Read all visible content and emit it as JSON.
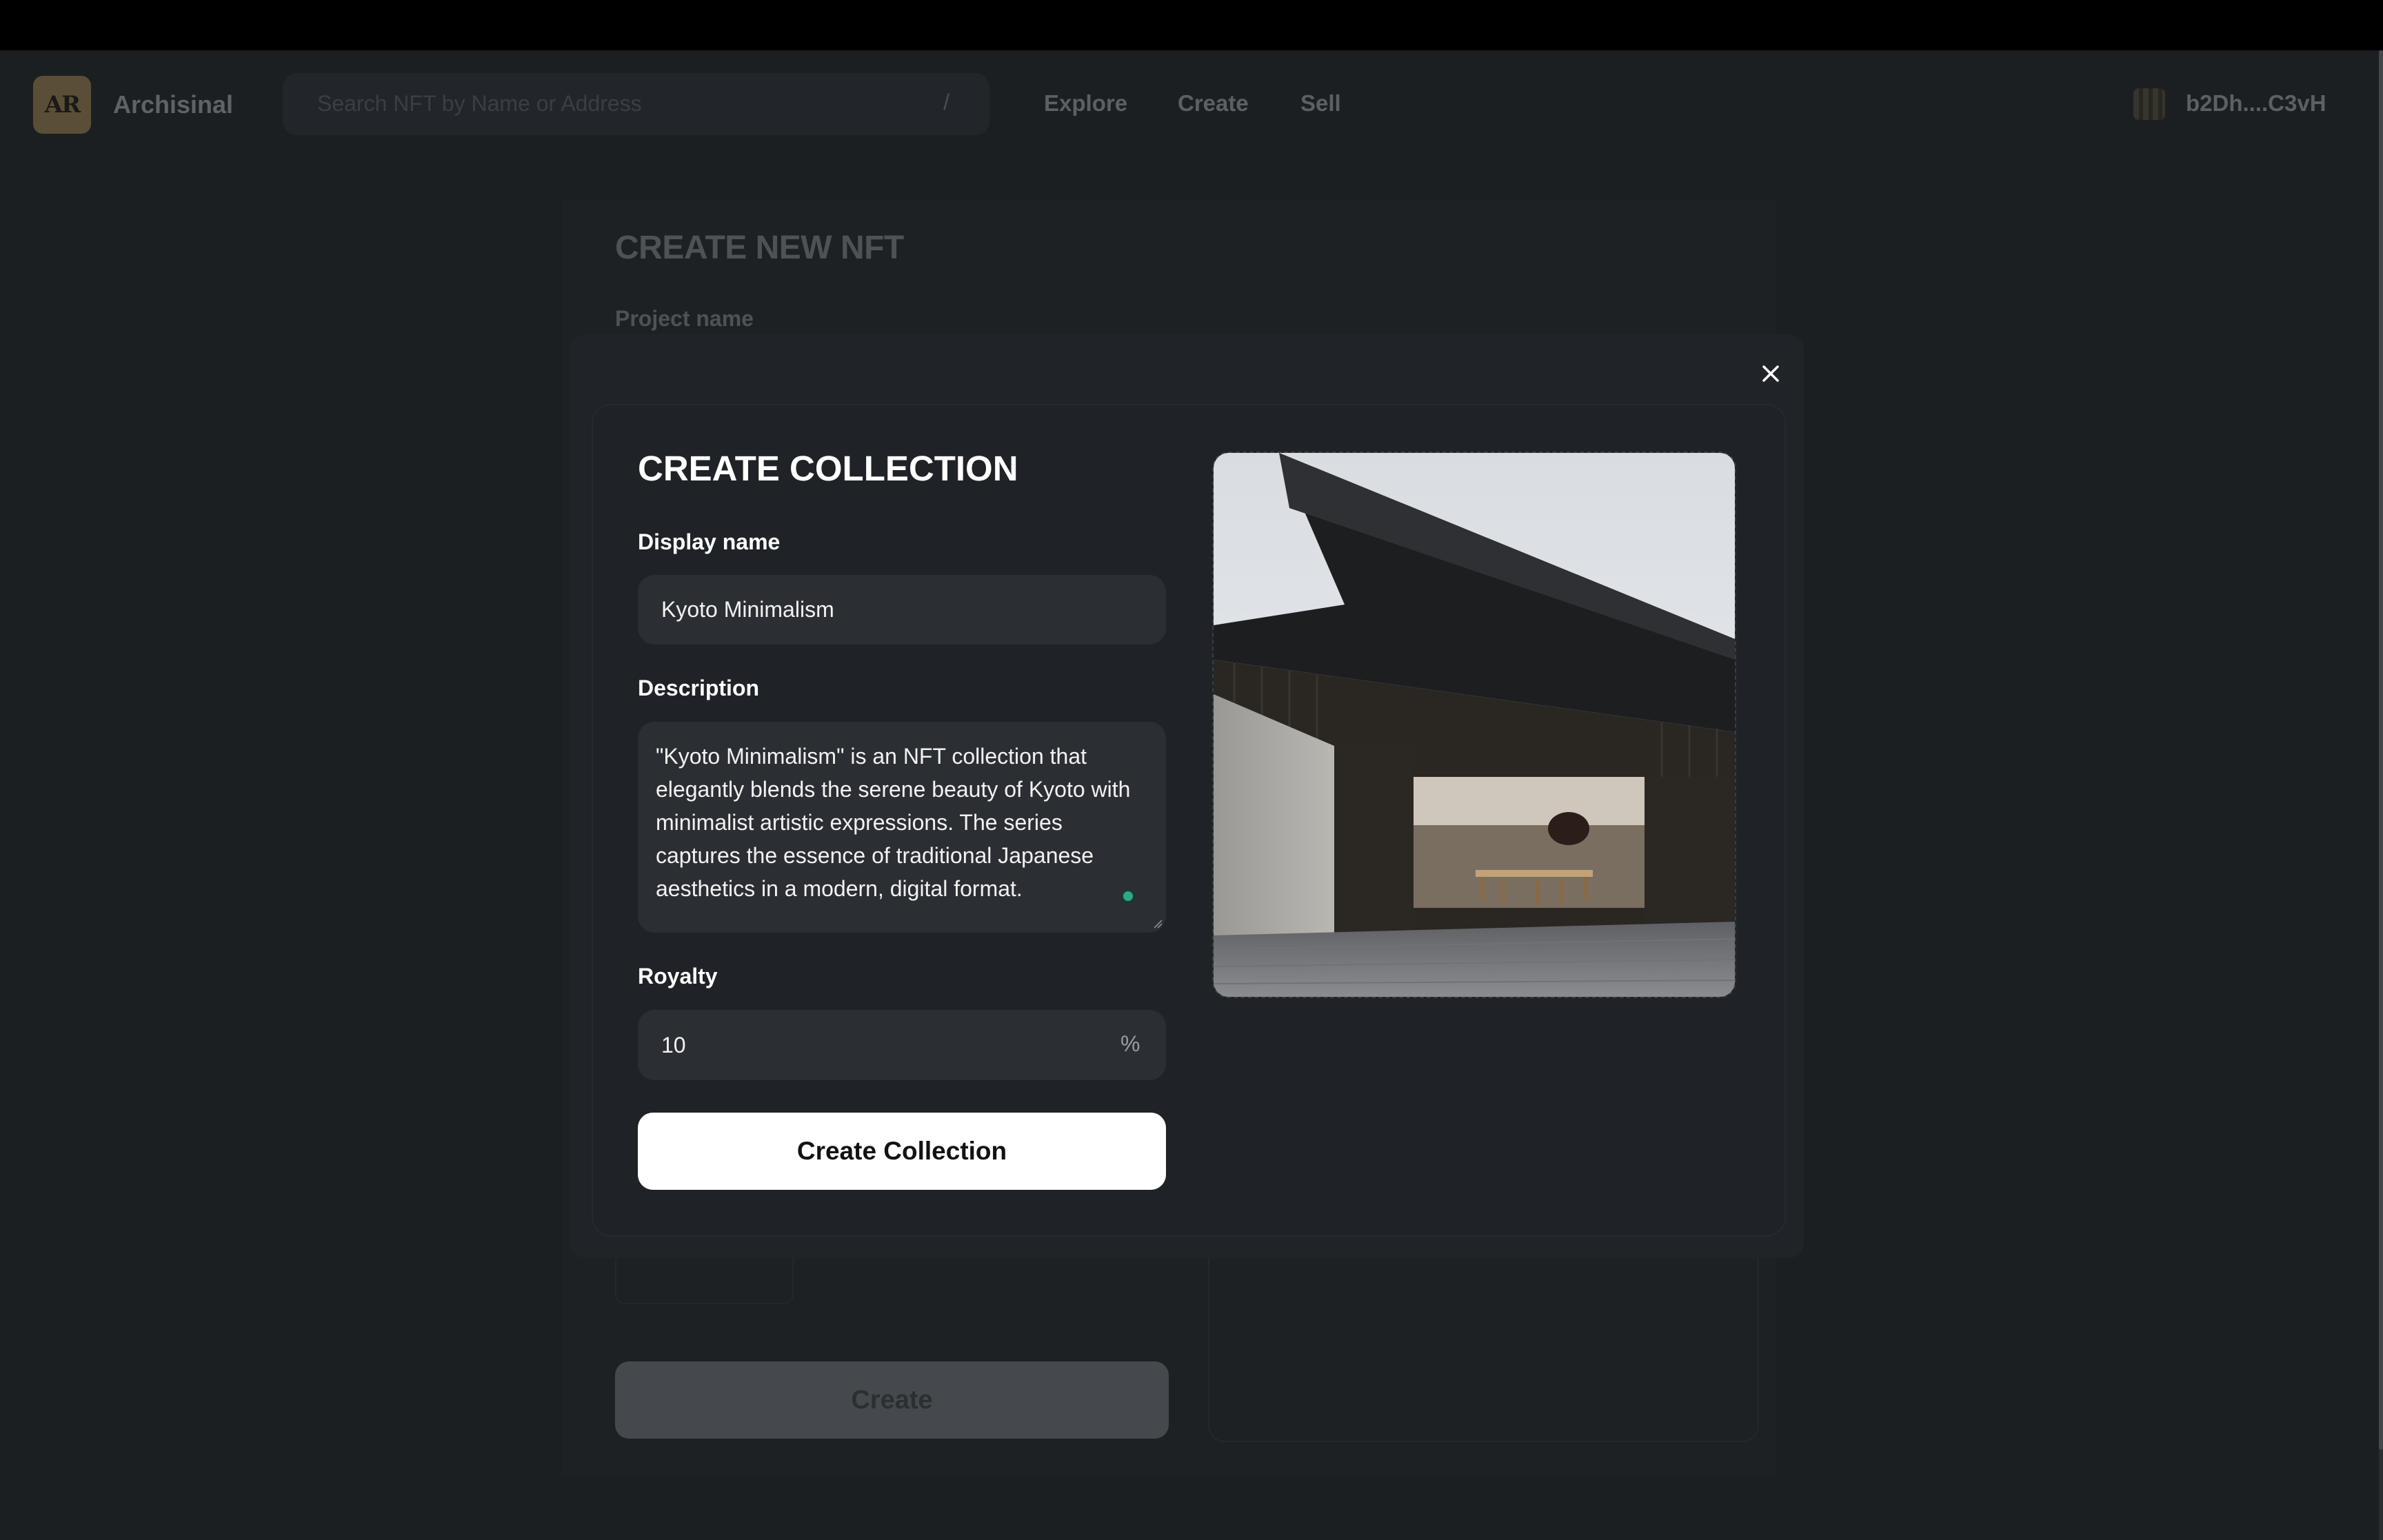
{
  "header": {
    "logo_text": "AR",
    "brand": "Archisinal",
    "search_placeholder": "Search NFT by Name or Address",
    "search_shortcut": "/",
    "nav": [
      "Explore",
      "Create",
      "Sell"
    ],
    "wallet": "b2Dh....C3vH"
  },
  "background_page": {
    "title": "CREATE NEW NFT",
    "project_label": "Project name",
    "create_button": "Create"
  },
  "modal": {
    "title": "CREATE COLLECTION",
    "display_name_label": "Display name",
    "display_name_value": "Kyoto Minimalism",
    "description_label": "Description",
    "description_value": "\"Kyoto Minimalism\" is an NFT collection that elegantly blends the serene beauty of Kyoto with minimalist artistic expressions. The series captures the essence of traditional Japanese aesthetics in a modern, digital format.",
    "royalty_label": "Royalty",
    "royalty_value": "10",
    "royalty_unit": "%",
    "submit_button": "Create Collection",
    "close_icon": "close-icon",
    "preview_image": "house-photo"
  }
}
